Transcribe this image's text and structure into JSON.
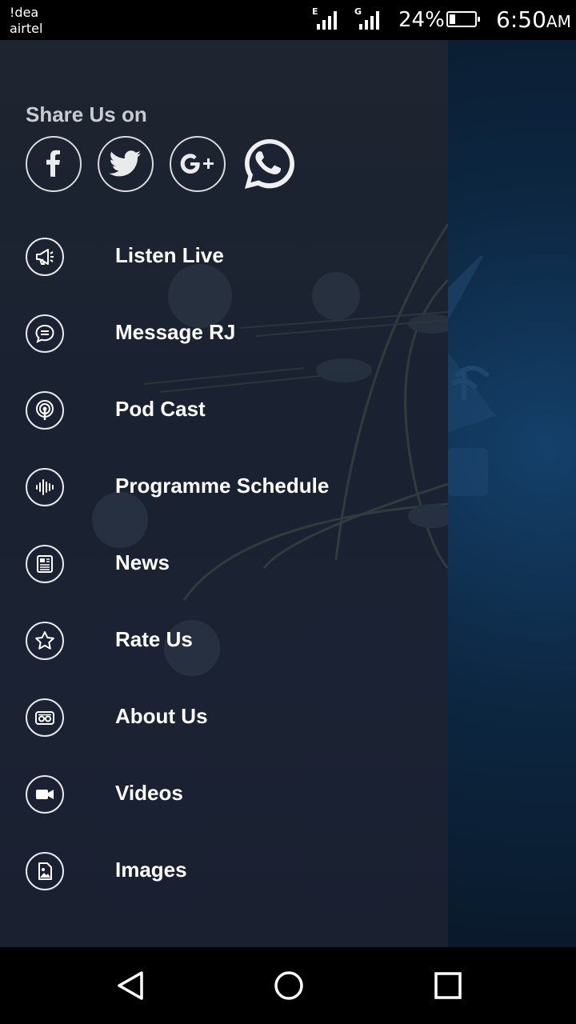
{
  "status_bar": {
    "carrier_1": "!dea",
    "carrier_2": "airtel",
    "signal_1_tag": "E",
    "signal_2_tag": "G",
    "battery_percent": "24%",
    "battery_level": 0.24,
    "time": "6:50",
    "time_suffix": "AM"
  },
  "drawer": {
    "share_title": "Share Us on",
    "social": [
      {
        "name": "facebook-icon"
      },
      {
        "name": "twitter-icon"
      },
      {
        "name": "google-plus-icon"
      },
      {
        "name": "whatsapp-icon"
      }
    ],
    "menu": [
      {
        "label": "Listen Live",
        "icon": "megaphone-icon"
      },
      {
        "label": "Message RJ",
        "icon": "chat-bubble-icon"
      },
      {
        "label": "Pod Cast",
        "icon": "podcast-icon"
      },
      {
        "label": "Programme Schedule",
        "icon": "waveform-icon"
      },
      {
        "label": "News",
        "icon": "newspaper-icon"
      },
      {
        "label": "Rate Us",
        "icon": "star-icon"
      },
      {
        "label": "About Us",
        "icon": "radio-icon"
      },
      {
        "label": "Videos",
        "icon": "video-camera-icon"
      },
      {
        "label": "Images",
        "icon": "image-icon"
      }
    ]
  },
  "colors": {
    "drawer_bg": "#1c2332",
    "icon_border": "#e6e8eb",
    "share_title": "#c8ccd2"
  }
}
